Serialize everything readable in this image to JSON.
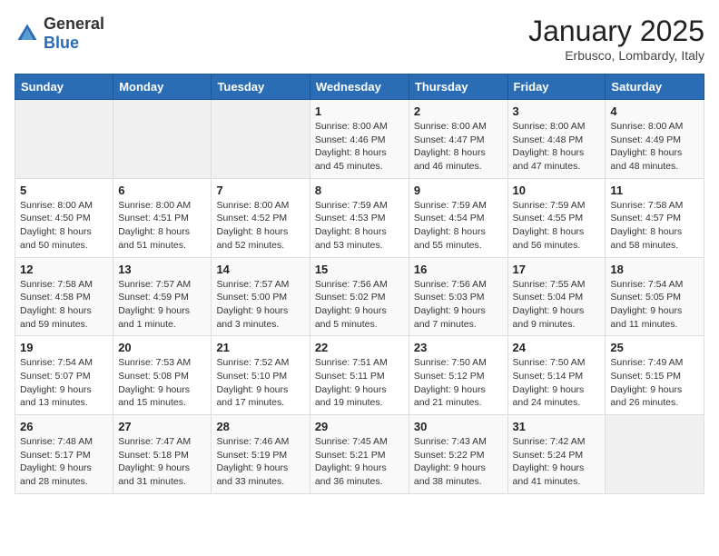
{
  "header": {
    "logo_general": "General",
    "logo_blue": "Blue",
    "month_title": "January 2025",
    "location": "Erbusco, Lombardy, Italy"
  },
  "days_of_week": [
    "Sunday",
    "Monday",
    "Tuesday",
    "Wednesday",
    "Thursday",
    "Friday",
    "Saturday"
  ],
  "weeks": [
    [
      {
        "day": "",
        "info": ""
      },
      {
        "day": "",
        "info": ""
      },
      {
        "day": "",
        "info": ""
      },
      {
        "day": "1",
        "info": "Sunrise: 8:00 AM\nSunset: 4:46 PM\nDaylight: 8 hours and 45 minutes."
      },
      {
        "day": "2",
        "info": "Sunrise: 8:00 AM\nSunset: 4:47 PM\nDaylight: 8 hours and 46 minutes."
      },
      {
        "day": "3",
        "info": "Sunrise: 8:00 AM\nSunset: 4:48 PM\nDaylight: 8 hours and 47 minutes."
      },
      {
        "day": "4",
        "info": "Sunrise: 8:00 AM\nSunset: 4:49 PM\nDaylight: 8 hours and 48 minutes."
      }
    ],
    [
      {
        "day": "5",
        "info": "Sunrise: 8:00 AM\nSunset: 4:50 PM\nDaylight: 8 hours and 50 minutes."
      },
      {
        "day": "6",
        "info": "Sunrise: 8:00 AM\nSunset: 4:51 PM\nDaylight: 8 hours and 51 minutes."
      },
      {
        "day": "7",
        "info": "Sunrise: 8:00 AM\nSunset: 4:52 PM\nDaylight: 8 hours and 52 minutes."
      },
      {
        "day": "8",
        "info": "Sunrise: 7:59 AM\nSunset: 4:53 PM\nDaylight: 8 hours and 53 minutes."
      },
      {
        "day": "9",
        "info": "Sunrise: 7:59 AM\nSunset: 4:54 PM\nDaylight: 8 hours and 55 minutes."
      },
      {
        "day": "10",
        "info": "Sunrise: 7:59 AM\nSunset: 4:55 PM\nDaylight: 8 hours and 56 minutes."
      },
      {
        "day": "11",
        "info": "Sunrise: 7:58 AM\nSunset: 4:57 PM\nDaylight: 8 hours and 58 minutes."
      }
    ],
    [
      {
        "day": "12",
        "info": "Sunrise: 7:58 AM\nSunset: 4:58 PM\nDaylight: 8 hours and 59 minutes."
      },
      {
        "day": "13",
        "info": "Sunrise: 7:57 AM\nSunset: 4:59 PM\nDaylight: 9 hours and 1 minute."
      },
      {
        "day": "14",
        "info": "Sunrise: 7:57 AM\nSunset: 5:00 PM\nDaylight: 9 hours and 3 minutes."
      },
      {
        "day": "15",
        "info": "Sunrise: 7:56 AM\nSunset: 5:02 PM\nDaylight: 9 hours and 5 minutes."
      },
      {
        "day": "16",
        "info": "Sunrise: 7:56 AM\nSunset: 5:03 PM\nDaylight: 9 hours and 7 minutes."
      },
      {
        "day": "17",
        "info": "Sunrise: 7:55 AM\nSunset: 5:04 PM\nDaylight: 9 hours and 9 minutes."
      },
      {
        "day": "18",
        "info": "Sunrise: 7:54 AM\nSunset: 5:05 PM\nDaylight: 9 hours and 11 minutes."
      }
    ],
    [
      {
        "day": "19",
        "info": "Sunrise: 7:54 AM\nSunset: 5:07 PM\nDaylight: 9 hours and 13 minutes."
      },
      {
        "day": "20",
        "info": "Sunrise: 7:53 AM\nSunset: 5:08 PM\nDaylight: 9 hours and 15 minutes."
      },
      {
        "day": "21",
        "info": "Sunrise: 7:52 AM\nSunset: 5:10 PM\nDaylight: 9 hours and 17 minutes."
      },
      {
        "day": "22",
        "info": "Sunrise: 7:51 AM\nSunset: 5:11 PM\nDaylight: 9 hours and 19 minutes."
      },
      {
        "day": "23",
        "info": "Sunrise: 7:50 AM\nSunset: 5:12 PM\nDaylight: 9 hours and 21 minutes."
      },
      {
        "day": "24",
        "info": "Sunrise: 7:50 AM\nSunset: 5:14 PM\nDaylight: 9 hours and 24 minutes."
      },
      {
        "day": "25",
        "info": "Sunrise: 7:49 AM\nSunset: 5:15 PM\nDaylight: 9 hours and 26 minutes."
      }
    ],
    [
      {
        "day": "26",
        "info": "Sunrise: 7:48 AM\nSunset: 5:17 PM\nDaylight: 9 hours and 28 minutes."
      },
      {
        "day": "27",
        "info": "Sunrise: 7:47 AM\nSunset: 5:18 PM\nDaylight: 9 hours and 31 minutes."
      },
      {
        "day": "28",
        "info": "Sunrise: 7:46 AM\nSunset: 5:19 PM\nDaylight: 9 hours and 33 minutes."
      },
      {
        "day": "29",
        "info": "Sunrise: 7:45 AM\nSunset: 5:21 PM\nDaylight: 9 hours and 36 minutes."
      },
      {
        "day": "30",
        "info": "Sunrise: 7:43 AM\nSunset: 5:22 PM\nDaylight: 9 hours and 38 minutes."
      },
      {
        "day": "31",
        "info": "Sunrise: 7:42 AM\nSunset: 5:24 PM\nDaylight: 9 hours and 41 minutes."
      },
      {
        "day": "",
        "info": ""
      }
    ]
  ]
}
